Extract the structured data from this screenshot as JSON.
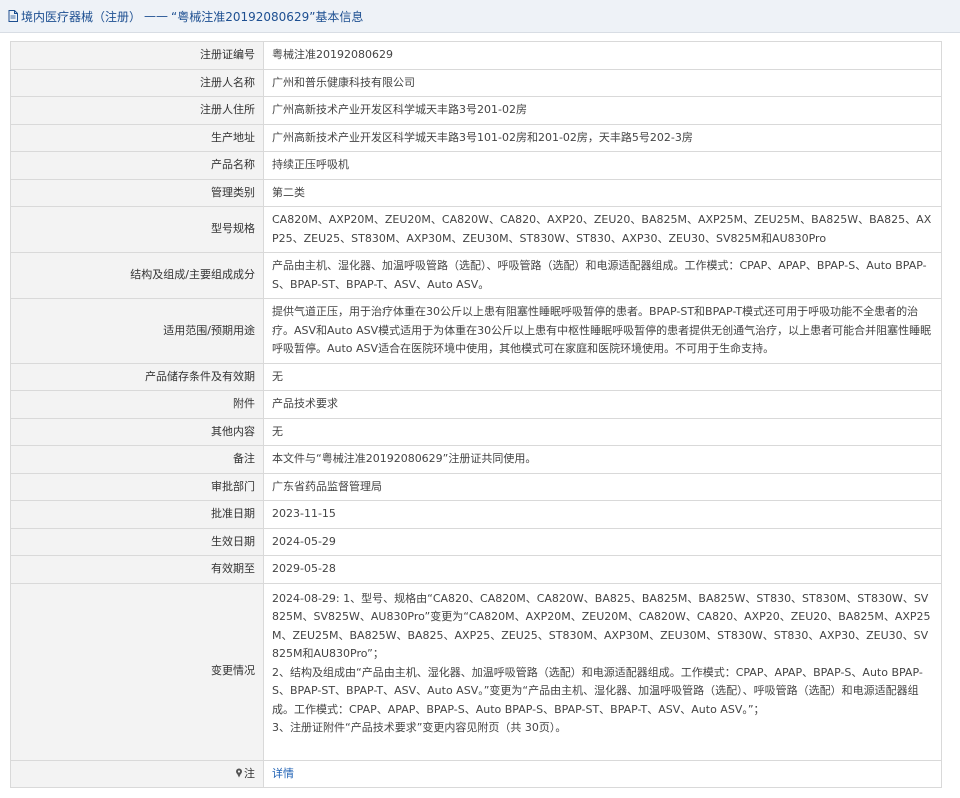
{
  "header": {
    "prefix": "境内医疗器械（注册）",
    "separator": "——",
    "title": "“粤械注准20192080629”基本信息"
  },
  "rows": [
    {
      "label": "注册证编号",
      "value": "粤械注准20192080629"
    },
    {
      "label": "注册人名称",
      "value": "广州和普乐健康科技有限公司"
    },
    {
      "label": "注册人住所",
      "value": "广州高新技术产业开发区科学城天丰路3号201-02房"
    },
    {
      "label": "生产地址",
      "value": "广州高新技术产业开发区科学城天丰路3号101-02房和201-02房，天丰路5号202-3房"
    },
    {
      "label": "产品名称",
      "value": "持续正压呼吸机"
    },
    {
      "label": "管理类别",
      "value": "第二类"
    },
    {
      "label": "型号规格",
      "value": "CA820M、AXP20M、ZEU20M、CA820W、CA820、AXP20、ZEU20、BA825M、AXP25M、ZEU25M、BA825W、BA825、AXP25、ZEU25、ST830M、AXP30M、ZEU30M、ST830W、ST830、AXP30、ZEU30、SV825M和AU830Pro"
    },
    {
      "label": "结构及组成/主要组成成分",
      "value": "产品由主机、湿化器、加温呼吸管路（选配）、呼吸管路（选配）和电源适配器组成。工作模式：CPAP、APAP、BPAP-S、Auto BPAP-S、BPAP-ST、BPAP-T、ASV、Auto ASV。"
    },
    {
      "label": "适用范围/预期用途",
      "value": "提供气道正压，用于治疗体重在30公斤以上患有阻塞性睡眠呼吸暂停的患者。BPAP-ST和BPAP-T模式还可用于呼吸功能不全患者的治疗。ASV和Auto ASV模式适用于为体重在30公斤以上患有中枢性睡眠呼吸暂停的患者提供无创通气治疗，以上患者可能合并阻塞性睡眠呼吸暂停。Auto ASV适合在医院环境中使用，其他模式可在家庭和医院环境使用。不可用于生命支持。"
    },
    {
      "label": "产品储存条件及有效期",
      "value": "无"
    },
    {
      "label": "附件",
      "value": "产品技术要求"
    },
    {
      "label": "其他内容",
      "value": "无"
    },
    {
      "label": "备注",
      "value": "本文件与“粤械注准20192080629”注册证共同使用。"
    },
    {
      "label": "审批部门",
      "value": "广东省药品监督管理局"
    },
    {
      "label": "批准日期",
      "value": "2023-11-15"
    },
    {
      "label": "生效日期",
      "value": "2024-05-29"
    },
    {
      "label": "有效期至",
      "value": "2029-05-28"
    }
  ],
  "change": {
    "label": "变更情况",
    "lines": [
      "2024-08-29: 1、型号、规格由“CA820、CA820M、CA820W、BA825、BA825M、BA825W、ST830、ST830M、ST830W、SV825M、SV825W、AU830Pro”变更为“CA820M、AXP20M、ZEU20M、CA820W、CA820、AXP20、ZEU20、BA825M、AXP25M、ZEU25M、BA825W、BA825、AXP25、ZEU25、ST830M、AXP30M、ZEU30M、ST830W、ST830、AXP30、ZEU30、SV825M和AU830Pro”；",
      "2、结构及组成由“产品由主机、湿化器、加温呼吸管路（选配）和电源适配器组成。工作模式：CPAP、APAP、BPAP-S、Auto BPAP-S、BPAP-ST、BPAP-T、ASV、Auto ASV。”变更为“产品由主机、湿化器、加温呼吸管路（选配）、呼吸管路（选配）和电源适配器组成。工作模式：CPAP、APAP、BPAP-S、Auto BPAP-S、BPAP-ST、BPAP-T、ASV、Auto ASV。”；",
      "3、注册证附件“产品技术要求”变更内容见附页（共 30页）。"
    ]
  },
  "note": {
    "label": "注",
    "link_text": "详情"
  },
  "colors": {
    "title": "#1d4f91",
    "label_bg": "#f3f3f3",
    "link": "#1c5fb3"
  }
}
